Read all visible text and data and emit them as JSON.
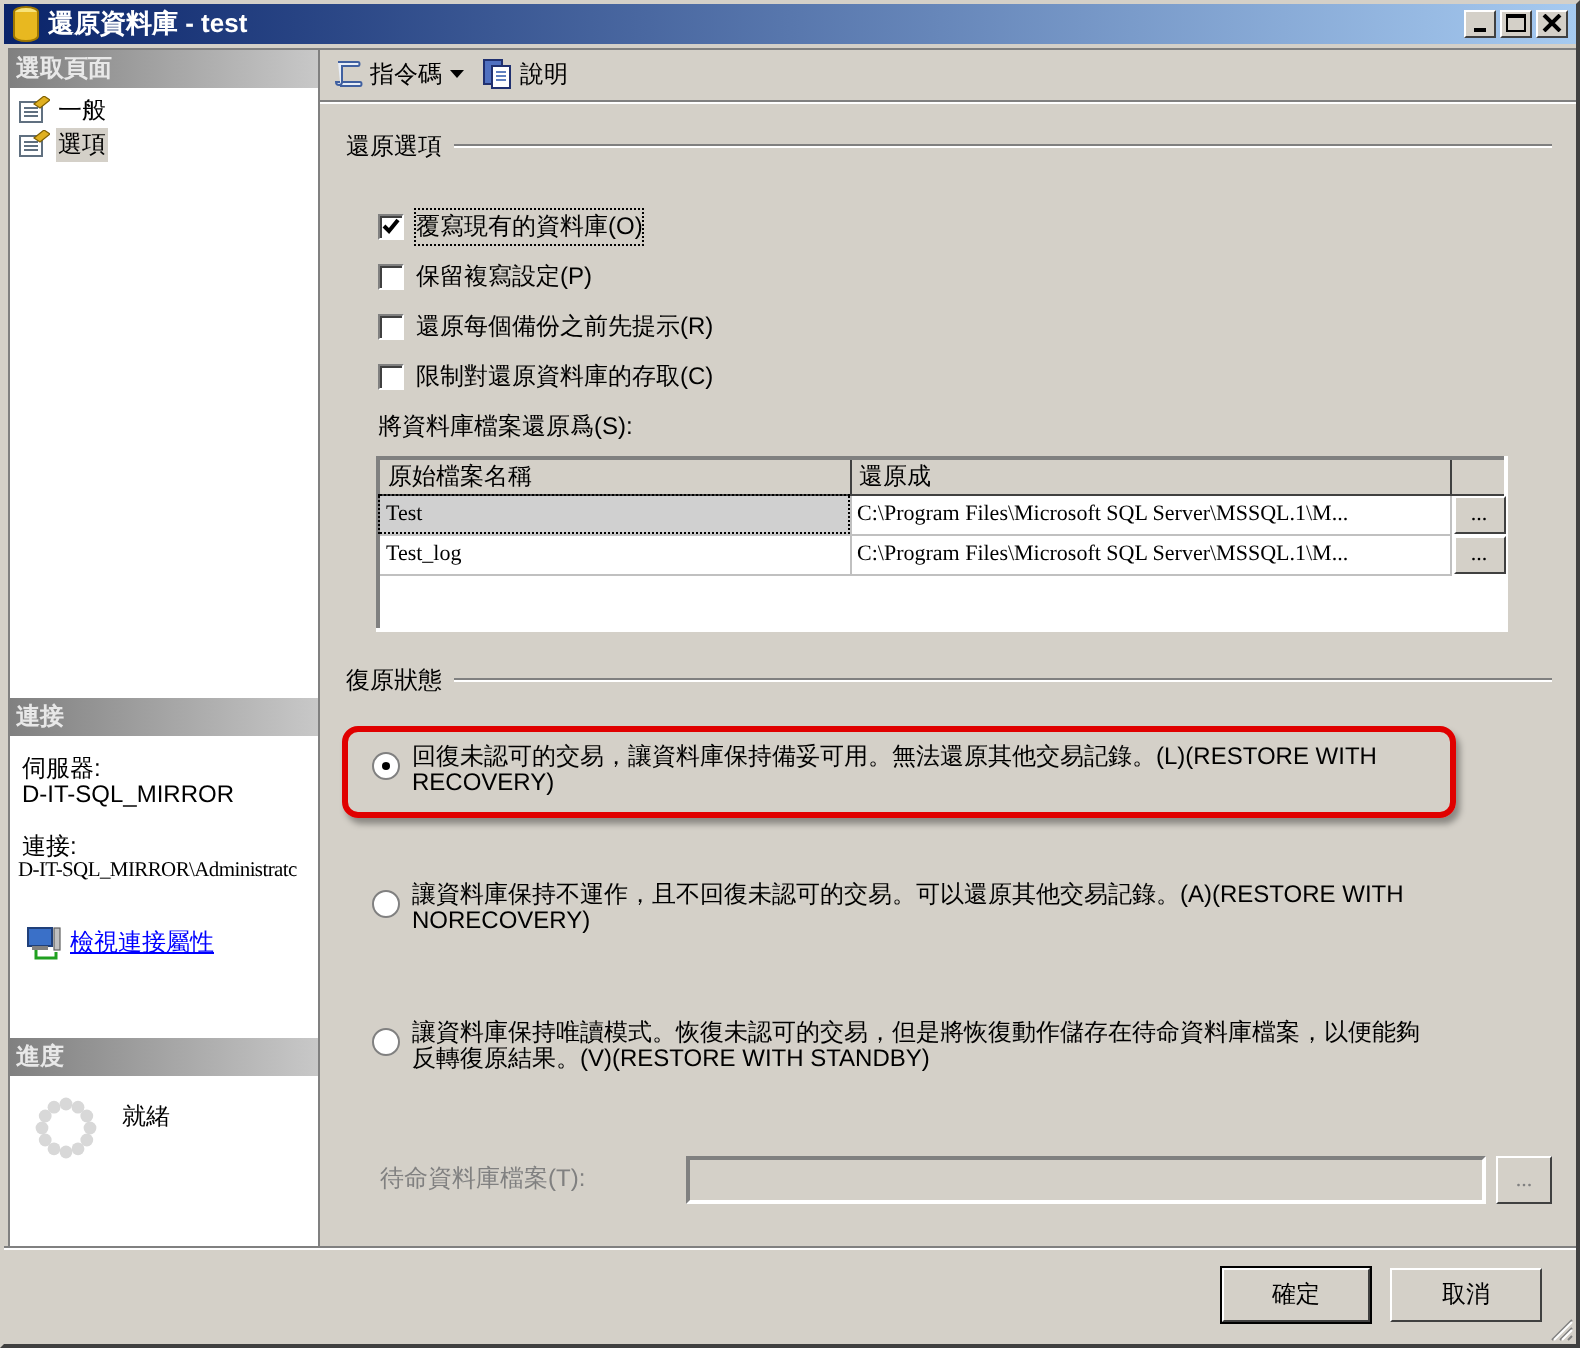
{
  "window": {
    "title": "還原資料庫 - test"
  },
  "sidebar": {
    "pages_header": "選取頁面",
    "pages": [
      {
        "label": "一般",
        "selected": false
      },
      {
        "label": "選項",
        "selected": true
      }
    ],
    "connection_header": "連接",
    "server_label": "伺服器:",
    "server": "D-IT-SQL_MIRROR",
    "connection_label": "連接:",
    "connection": "D-IT-SQL_MIRROR\\Administratc",
    "link": "檢視連接屬性",
    "progress_header": "進度",
    "progress_status": "就緒"
  },
  "toolbar": {
    "items": [
      {
        "label": "指令碼",
        "kind": "dropdown"
      },
      {
        "label": "說明",
        "kind": "help"
      }
    ]
  },
  "restore_options": {
    "title": "還原選項",
    "checkboxes": [
      {
        "label": "覆寫現有的資料庫(O)",
        "checked": true
      },
      {
        "label": "保留複寫設定(P)",
        "checked": false
      },
      {
        "label": "還原每個備份之前先提示(R)",
        "checked": false
      },
      {
        "label": "限制對還原資料庫的存取(C)",
        "checked": false
      }
    ],
    "files_label": "將資料庫檔案還原爲(S):",
    "table": {
      "columns": [
        "原始檔案名稱",
        "還原成"
      ],
      "rows": [
        {
          "original": "Test",
          "restore_as": "C:\\Program Files\\Microsoft SQL Server\\MSSQL.1\\M...",
          "browse": "...",
          "selected": true
        },
        {
          "original": "Test_log",
          "restore_as": "C:\\Program Files\\Microsoft SQL Server\\MSSQL.1\\M...",
          "browse": "...",
          "selected": false
        }
      ]
    }
  },
  "recovery_state": {
    "title": "復原狀態",
    "options": [
      {
        "text": "回復未認可的交易，讓資料庫保持備妥可用。無法還原其他交易記錄。(L)(RESTORE WITH RECOVERY)",
        "selected": true,
        "highlighted": true
      },
      {
        "text": "讓資料庫保持不運作，且不回復未認可的交易。可以還原其他交易記錄。(A)(RESTORE WITH NORECOVERY)",
        "selected": false,
        "highlighted": false
      },
      {
        "text": "讓資料庫保持唯讀模式。恢復未認可的交易，但是將恢復動作儲存在待命資料庫檔案，以便能夠反轉復原結果。(V)(RESTORE WITH STANDBY)",
        "selected": false,
        "highlighted": false
      }
    ],
    "standby_label": "待命資料庫檔案(T):",
    "standby_disabled": true,
    "standby_browse": "..."
  },
  "buttons": [
    {
      "label": "確定",
      "default": true
    },
    {
      "label": "取消",
      "default": false
    }
  ]
}
